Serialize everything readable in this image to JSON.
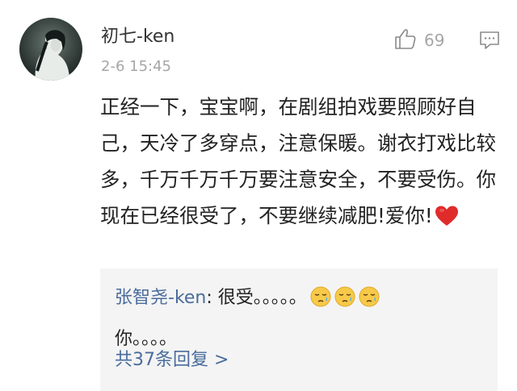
{
  "comment": {
    "username": "初七-ken",
    "timestamp": "2-6 15:45",
    "likes": "69",
    "text": "正经一下，宝宝啊，在剧组拍戏要照顾好自己，天冷了多穿点，注意保暖。谢衣打戏比较多，千万千万千万要注意安全，不要受伤。你现在已经很受了，不要继续减肥!爱你!",
    "text_emoji": "red-heart"
  },
  "reply": {
    "author": "张智尧-ken",
    "separator": ": ",
    "text": "很受。。。。。",
    "emojis": [
      "tearful-face",
      "tearful-face",
      "tearful-face"
    ],
    "text_continued": "你。。。。"
  },
  "more_replies_label": "共37条回复 >",
  "colors": {
    "link_blue": "#4a6c9c",
    "muted_gray": "#a6a6a6",
    "reply_bg": "#f4f4f4",
    "heart_red": "#e02b2b"
  }
}
